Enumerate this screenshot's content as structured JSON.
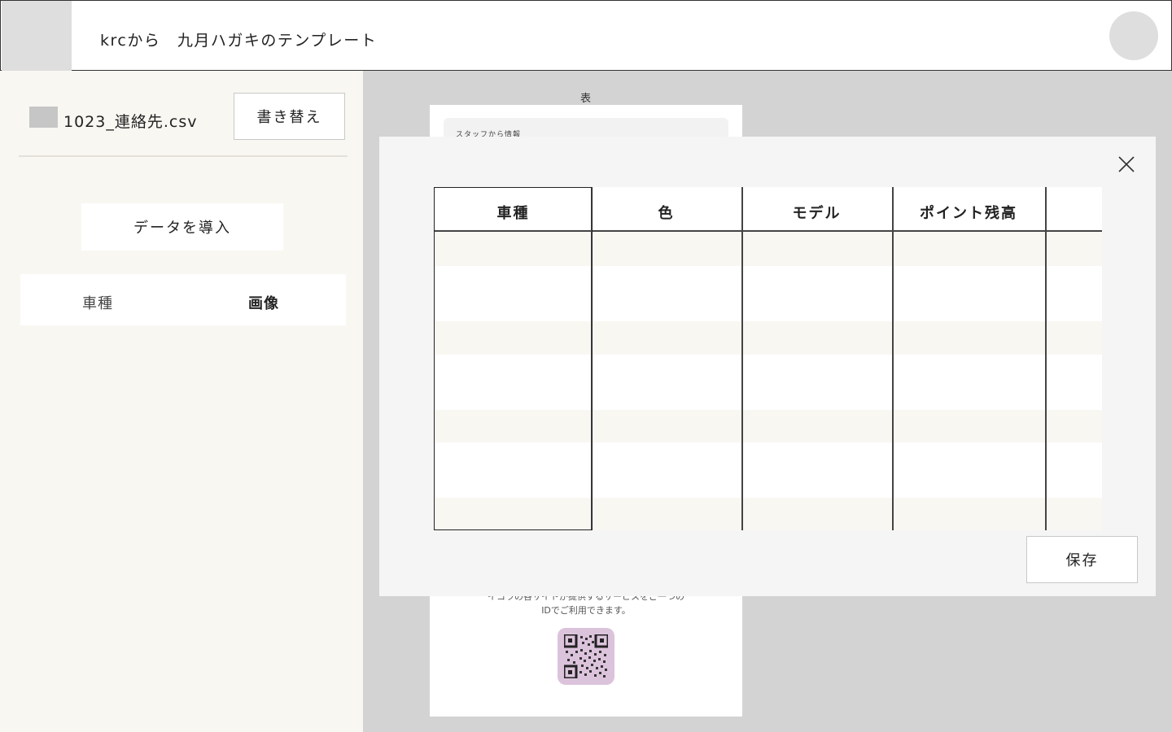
{
  "header": {
    "title": "krcから　九月ハガキのテンプレート"
  },
  "sidebar": {
    "file_name": "1023_連絡先.csv",
    "replace_label": "書き替え",
    "import_label": "データを導入",
    "tabs": [
      {
        "label": "車種"
      },
      {
        "label": "画像"
      }
    ]
  },
  "preview": {
    "label": "表",
    "info_bar_text": "スタッフから情報",
    "desc_line1": "イコラの各サイトが提供するサービスをご一つの",
    "desc_line2": "IDでご利用できます。"
  },
  "modal": {
    "columns": [
      "車種",
      "色",
      "モデル",
      "ポイント残高",
      ""
    ],
    "save_label": "保存"
  },
  "colors": {
    "sidebar_bg": "#f9f7f2",
    "stripe_bg": "#f9f7f2",
    "qr_bg": "#dcc3dc"
  }
}
